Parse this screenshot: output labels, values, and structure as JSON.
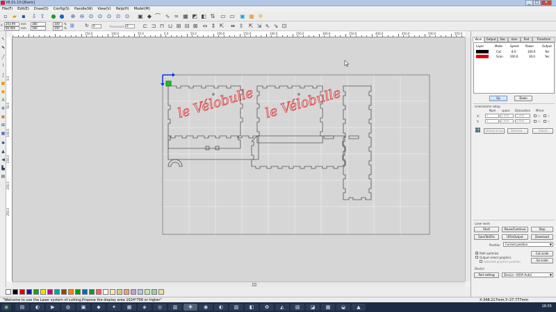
{
  "window": {
    "title": "V8.01.10-[Blank]",
    "controls": [
      "_",
      "□",
      "×"
    ]
  },
  "menu": [
    "File(F)",
    "Edit(E)",
    "Draw(D)",
    "Config(S)",
    "Handle(W)",
    "View(V)",
    "Help(H)",
    "Model(M)"
  ],
  "toolbar2": {
    "x_label": "X",
    "x_value": "203.99",
    "y_value": "66.906",
    "w_value": "380",
    "h_value": "160",
    "w_pct": "100",
    "h_pct": "100",
    "pct_unit": "%",
    "mm_unit": "mm",
    "angle_value": "0",
    "proc_label": "Processed NO",
    "proc_value": "0"
  },
  "ruler_top_ticks": [
    "0.0",
    "50.0",
    "100.0",
    "150.0",
    "200.0",
    "250.0",
    "300.0",
    "350.0",
    "400.0",
    "450.0",
    "500.0",
    "550.0"
  ],
  "ruler_top_ticks_lead": [
    "150.0",
    "100.0",
    "50.0"
  ],
  "ruler_left_ticks": [
    "0.0",
    "50.0",
    "100.0",
    "150.0",
    "200.0",
    "250.0"
  ],
  "design": {
    "text1": "le Vélobulle",
    "text2": "le Vélobulle"
  },
  "right_panel": {
    "tabs": [
      "Work",
      "Output",
      "Doc",
      "User",
      "Test",
      "Transform"
    ],
    "layer_headers": [
      "Layer",
      "Mode",
      "Speed",
      "Power",
      "Output"
    ],
    "layers": [
      {
        "color": "#000000",
        "mode": "Cut",
        "speed": "8.0",
        "power": "100.0",
        "output": "Yes"
      },
      {
        "color": "#e00000",
        "mode": "Scan",
        "speed": "200.0",
        "power": "30.0",
        "output": "Yes"
      }
    ],
    "up_label": "Up",
    "down_label": "Down",
    "array_title": "Line/column setup",
    "array_headers": [
      "Num",
      "space",
      "Dislocation",
      "Mirror"
    ],
    "array_rows": [
      {
        "axis": "X:",
        "num": "1",
        "space": "0.000",
        "dis": "0.000",
        "m": "H"
      },
      {
        "axis": "Y:",
        "num": "1",
        "space": "0.000",
        "dis": "0.000",
        "m": "V"
      }
    ],
    "virtual_array": "Virtual array",
    "bestrew": "Bestrew...",
    "adjust": "Adjust",
    "laser_work": "Laser work",
    "start": "Start",
    "pause": "Pause/Continue",
    "stop": "Stop",
    "save_file": "SaveToUFile",
    "ufile_output": "UFileOutput",
    "download": "Download",
    "position_label": "Position",
    "position_value": "Current position",
    "path_optimize": "Path optimize",
    "output_select": "Output select graphics",
    "selected_pos": "Selected graphics position",
    "cut_scale": "Cut scale",
    "go_scale": "Go scale",
    "device_label": "Device",
    "port_setting": "Port setting",
    "device_value": "Device---0(0#-Auto)"
  },
  "palette": [
    "#ffffff",
    "#000000",
    "#e00000",
    "#1c1ca8",
    "#1ea01e",
    "#e8e800",
    "#c80080",
    "#00a8a8",
    "#8a4b14",
    "#ff8000",
    "#00a000",
    "#0070c0",
    "#2c8a3c",
    "#ff6060",
    "#ffffff",
    "#ffe8b0",
    "#d0d080",
    "#f0a070",
    "#c8a0d0",
    "#b0c8e8",
    "#c8e8b0",
    "#a0d0a0",
    "#e8e0a8"
  ],
  "status": {
    "message": "\"Welcome to use the Laser system of cutting,Propose the display area 1024*768 or higher\"",
    "coords": "X:348.217mm,Y:-27.777mm"
  },
  "clock": "18:55"
}
